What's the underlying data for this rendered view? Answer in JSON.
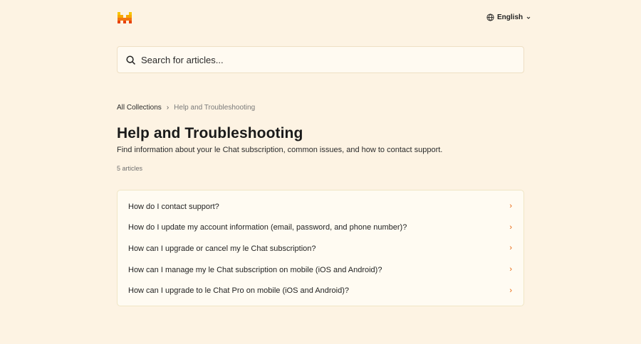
{
  "header": {
    "language": "English"
  },
  "search": {
    "placeholder": "Search for articles..."
  },
  "breadcrumb": {
    "root": "All Collections",
    "current": "Help and Troubleshooting"
  },
  "collection": {
    "title": "Help and Troubleshooting",
    "description": "Find information about your le Chat subscription, common issues, and how to contact support.",
    "article_count": "5 articles"
  },
  "articles": [
    {
      "label": "How do I contact support?"
    },
    {
      "label": "How do I update my account information (email, password, and phone number)?"
    },
    {
      "label": "How can I upgrade or cancel my le Chat subscription?"
    },
    {
      "label": "How can I manage my le Chat subscription on mobile (iOS and Android)?"
    },
    {
      "label": "How can I upgrade to le Chat Pro on mobile (iOS and Android)?"
    }
  ],
  "colors": {
    "background": "#fdf3e3",
    "accent": "#e8650d",
    "logo_top": "#f7b500",
    "logo_bottom": "#e8420c"
  }
}
